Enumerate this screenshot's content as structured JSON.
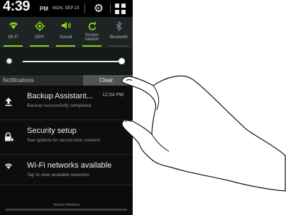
{
  "status_bar": {
    "time": "4:39",
    "ampm": "PM",
    "date": "MON, SEP 23"
  },
  "quick_settings": [
    {
      "label": "Wi-Fi",
      "icon": "wifi-icon",
      "active": true
    },
    {
      "label": "GPS",
      "icon": "gps-icon",
      "active": true
    },
    {
      "label": "Sound",
      "icon": "sound-icon",
      "active": true
    },
    {
      "label": "Screen rotation",
      "icon": "rotation-icon",
      "active": true
    },
    {
      "label": "Bluetooth",
      "icon": "bluetooth-icon",
      "active": false
    }
  ],
  "brightness": {
    "icon": "brightness-icon",
    "level": 0.96
  },
  "notifications": {
    "header": "Notifications",
    "clear_label": "Clear",
    "items": [
      {
        "title": "Backup Assistant...",
        "subtitle": "Backup successfully completed",
        "time": "12:04 PM",
        "icon": "upload-icon"
      },
      {
        "title": "Security setup",
        "subtitle": "See options for secure lock screens",
        "time": "",
        "icon": "lock-icon"
      },
      {
        "title": "Wi-Fi networks available",
        "subtitle": "Tap to view available networks",
        "time": "",
        "icon": "wifi-icon"
      }
    ]
  },
  "carrier": "Verizon Wireless",
  "colors": {
    "accent": "#8bd11e",
    "background": "#0b0b0b",
    "panel": "#1e2424"
  }
}
